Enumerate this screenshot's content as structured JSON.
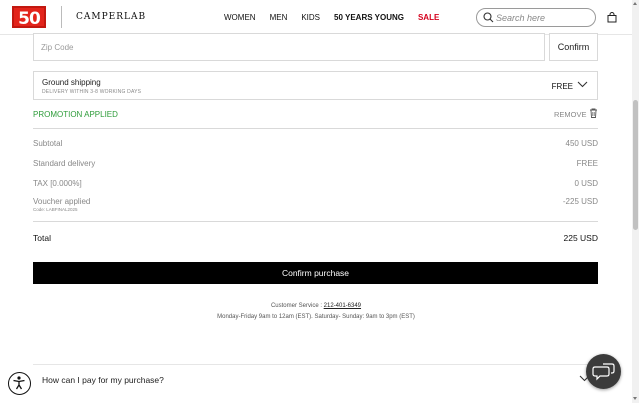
{
  "header": {
    "logo_text": "50",
    "brand": "CAMPERLAB",
    "nav": [
      "WOMEN",
      "MEN",
      "KIDS",
      "50 YEARS YOUNG",
      "SALE"
    ],
    "search_placeholder": "Search here",
    "sale_color": "#d5001c"
  },
  "zip": {
    "placeholder": "Zip Code",
    "button": "Confirm"
  },
  "shipping": {
    "title": "Ground shipping",
    "subtitle": "DELIVERY WITHIN 3-8 WORKING DAYS",
    "price": "FREE"
  },
  "promotion": {
    "label": "PROMOTION APPLIED",
    "remove": "REMOVE",
    "color": "#2e9c3a"
  },
  "summary": {
    "subtotal_label": "Subtotal",
    "subtotal": "450 USD",
    "delivery_label": "Standard delivery",
    "delivery": "FREE",
    "tax_label": "TAX [0.000%]",
    "tax": "0 USD",
    "voucher_label": "Voucher applied",
    "voucher_code": "Code: LABFINAL2025",
    "voucher": "-225 USD",
    "total_label": "Total",
    "total": "225 USD"
  },
  "confirm_purchase": "Confirm purchase",
  "customer_service": {
    "label": "Customer Service :",
    "phone": "212-401-6349",
    "hours": "Monday-Friday 9am to 12am (EST). Saturday- Sunday: 9am to 3pm (EST)"
  },
  "faq": {
    "question": "How can I pay for my purchase?"
  },
  "icons": [
    "search-icon",
    "shopping-bag-icon",
    "chevron-down-icon",
    "trash-icon",
    "accessibility-icon",
    "chat-icon"
  ]
}
